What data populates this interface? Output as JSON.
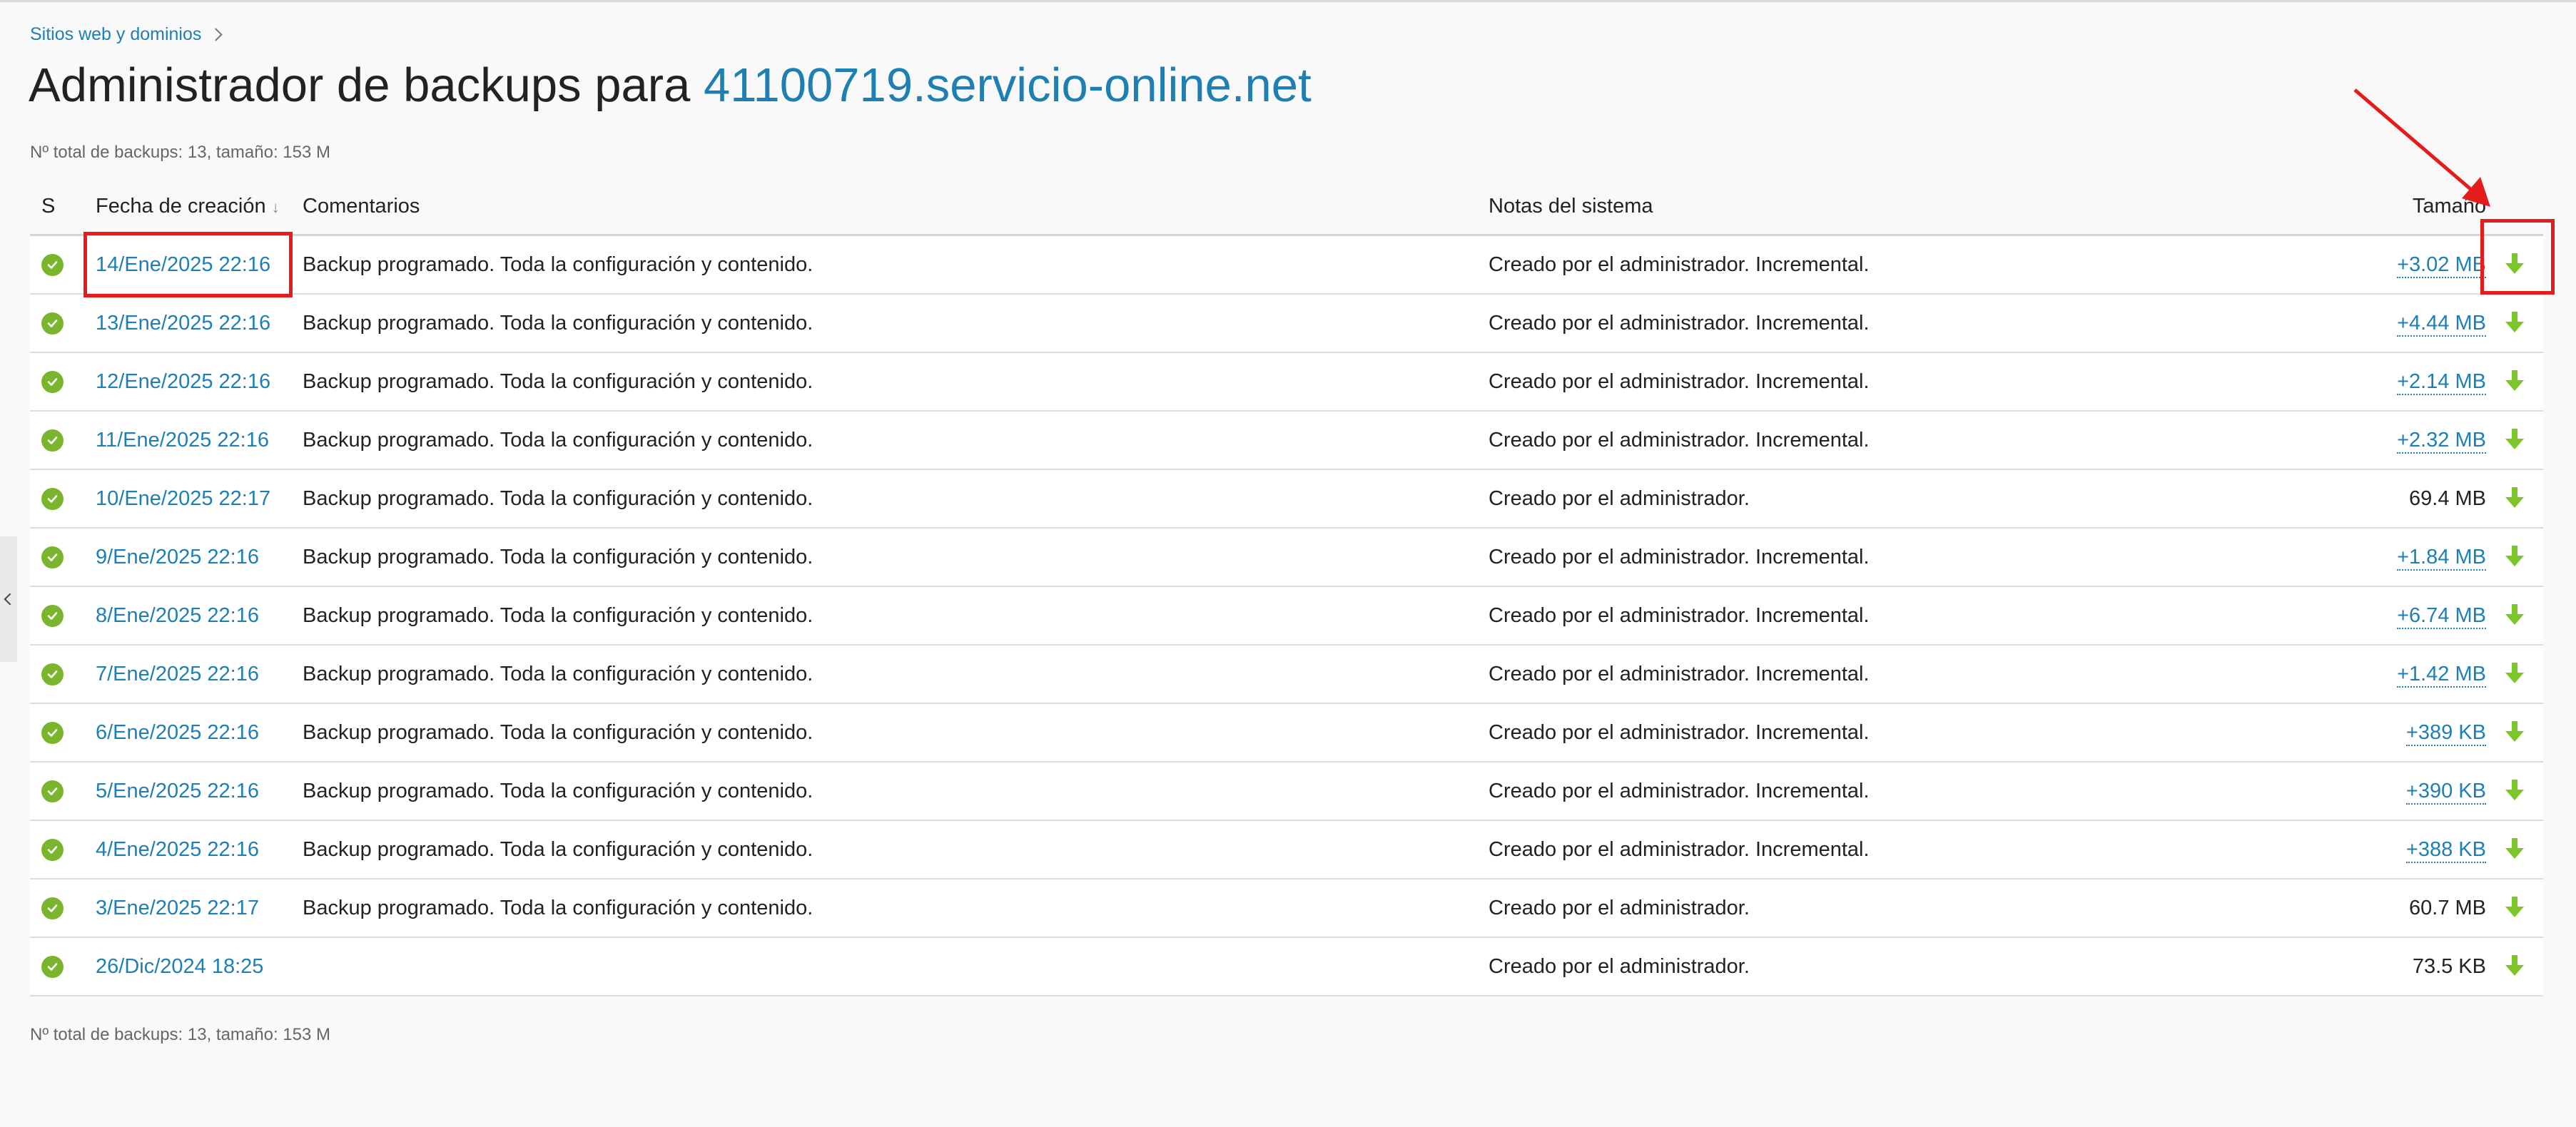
{
  "breadcrumb": {
    "label": "Sitios web y dominios"
  },
  "title": {
    "prefix": "Administrador de backups para ",
    "domain": "41100719.servicio-online.net"
  },
  "summary": "Nº total de backups: 13, tamaño: 153 M",
  "table": {
    "headers": {
      "status": "S",
      "date": "Fecha de creación",
      "comments": "Comentarios",
      "notes": "Notas del sistema",
      "size": "Tamaño"
    },
    "sort_indicator": "↓",
    "rows": [
      {
        "date": "14/Ene/2025 22:16",
        "comment": "Backup programado. Toda la configuración y contenido.",
        "notes": "Creado por el administrador. Incremental.",
        "size": "+3.02 MB",
        "size_link": true
      },
      {
        "date": "13/Ene/2025 22:16",
        "comment": "Backup programado. Toda la configuración y contenido.",
        "notes": "Creado por el administrador. Incremental.",
        "size": "+4.44 MB",
        "size_link": true
      },
      {
        "date": "12/Ene/2025 22:16",
        "comment": "Backup programado. Toda la configuración y contenido.",
        "notes": "Creado por el administrador. Incremental.",
        "size": "+2.14 MB",
        "size_link": true
      },
      {
        "date": "11/Ene/2025 22:16",
        "comment": "Backup programado. Toda la configuración y contenido.",
        "notes": "Creado por el administrador. Incremental.",
        "size": "+2.32 MB",
        "size_link": true
      },
      {
        "date": "10/Ene/2025 22:17",
        "comment": "Backup programado. Toda la configuración y contenido.",
        "notes": "Creado por el administrador.",
        "size": "69.4 MB",
        "size_link": false
      },
      {
        "date": "9/Ene/2025 22:16",
        "comment": "Backup programado. Toda la configuración y contenido.",
        "notes": "Creado por el administrador. Incremental.",
        "size": "+1.84 MB",
        "size_link": true
      },
      {
        "date": "8/Ene/2025 22:16",
        "comment": "Backup programado. Toda la configuración y contenido.",
        "notes": "Creado por el administrador. Incremental.",
        "size": "+6.74 MB",
        "size_link": true
      },
      {
        "date": "7/Ene/2025 22:16",
        "comment": "Backup programado. Toda la configuración y contenido.",
        "notes": "Creado por el administrador. Incremental.",
        "size": "+1.42 MB",
        "size_link": true
      },
      {
        "date": "6/Ene/2025 22:16",
        "comment": "Backup programado. Toda la configuración y contenido.",
        "notes": "Creado por el administrador. Incremental.",
        "size": "+389 KB",
        "size_link": true
      },
      {
        "date": "5/Ene/2025 22:16",
        "comment": "Backup programado. Toda la configuración y contenido.",
        "notes": "Creado por el administrador. Incremental.",
        "size": "+390 KB",
        "size_link": true
      },
      {
        "date": "4/Ene/2025 22:16",
        "comment": "Backup programado. Toda la configuración y contenido.",
        "notes": "Creado por el administrador. Incremental.",
        "size": "+388 KB",
        "size_link": true
      },
      {
        "date": "3/Ene/2025 22:17",
        "comment": "Backup programado. Toda la configuración y contenido.",
        "notes": "Creado por el administrador.",
        "size": "60.7 MB",
        "size_link": false
      },
      {
        "date": "26/Dic/2024 18:25",
        "comment": "",
        "notes": "Creado por el administrador.",
        "size": "73.5 KB",
        "size_link": false
      }
    ]
  },
  "icons": {
    "status": "check-circle-icon",
    "download": "download-arrow-icon",
    "breadcrumb_separator": "chevron-right-icon",
    "side_panel_toggle": "chevron-left-icon"
  },
  "colors": {
    "link": "#1e7fb3",
    "status_ok": "#7bb52d",
    "download": "#7bc628",
    "annotation": "#e51c1c"
  }
}
